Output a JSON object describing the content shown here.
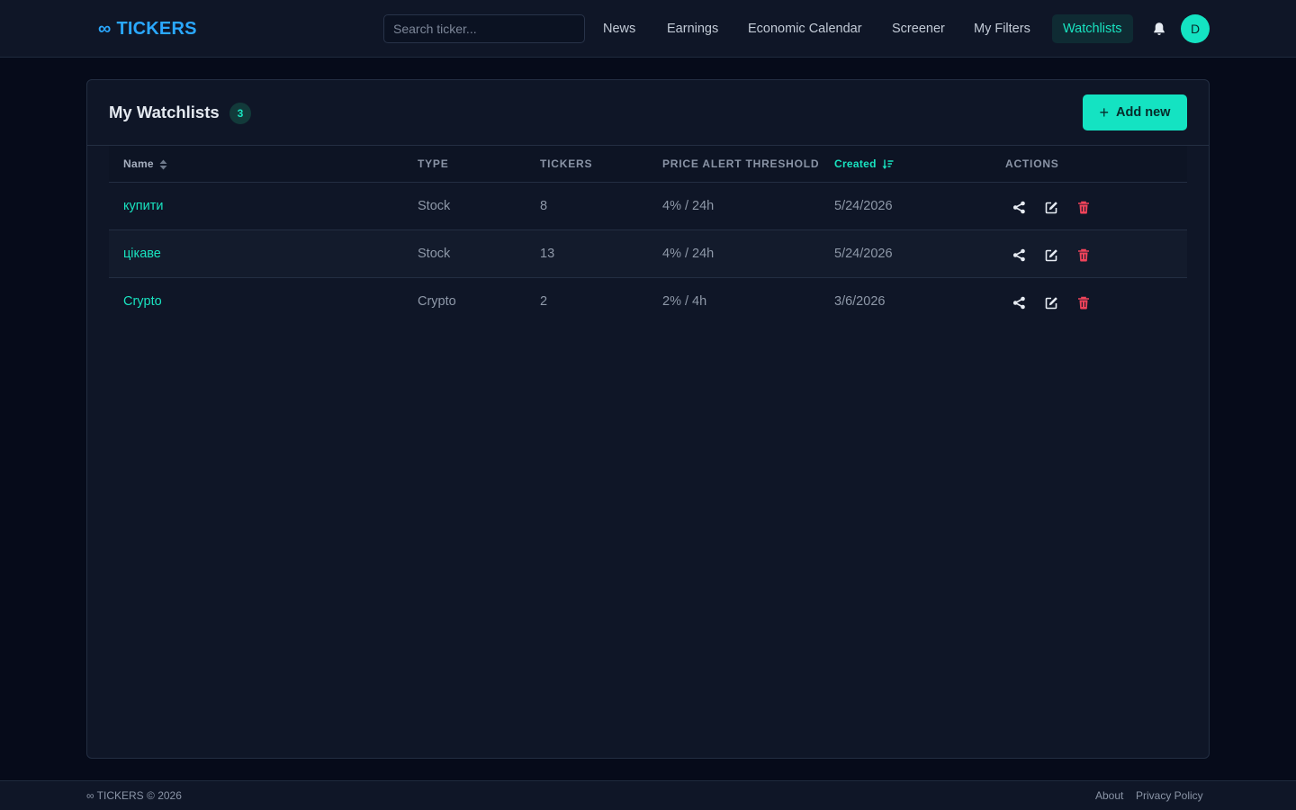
{
  "colors": {
    "accent": "#14e3c2",
    "brand": "#2aa8ff",
    "danger": "#f0435a",
    "background": "#060b1a",
    "panel": "#0f1627"
  },
  "header": {
    "logo_symbol": "∞",
    "logo_text": "TICKERS",
    "search_placeholder": "Search ticker...",
    "nav": [
      "News",
      "Earnings",
      "Economic Calendar",
      "Screener",
      "My Filters",
      "Watchlists"
    ],
    "active_nav": "Watchlists",
    "avatar_initial": "D",
    "icons": {
      "notifications": "bell-icon"
    }
  },
  "watchlists": {
    "title": "My Watchlists",
    "count": "3",
    "add_button": "Add new",
    "columns": {
      "name": "Name",
      "type": "TYPE",
      "tickers": "TICKERS",
      "threshold": "PRICE ALERT THRESHOLD",
      "created": "Created",
      "actions": "ACTIONS"
    },
    "sort": {
      "column": "created",
      "direction": "desc"
    },
    "rows": [
      {
        "name": "купити",
        "type": "Stock",
        "tickers": "8",
        "threshold": "4% / 24h",
        "created": "5/24/2026"
      },
      {
        "name": "цікаве",
        "type": "Stock",
        "tickers": "13",
        "threshold": "4% / 24h",
        "created": "5/24/2026"
      },
      {
        "name": "Crypto",
        "type": "Crypto",
        "tickers": "2",
        "threshold": "2% / 4h",
        "created": "3/6/2026"
      }
    ],
    "row_actions": [
      "share-icon",
      "edit-icon",
      "trash-icon"
    ]
  },
  "footer": {
    "copyright": "∞ TICKERS © 2026",
    "links": [
      "About",
      "Privacy Policy"
    ]
  }
}
